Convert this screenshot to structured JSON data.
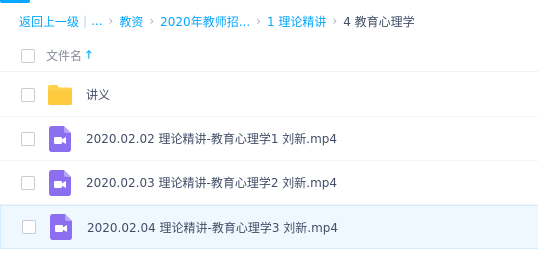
{
  "breadcrumb": {
    "back": "返回上一级",
    "ellipsis": "...",
    "items": [
      "教资",
      "2020年教师招...",
      "1 理论精讲"
    ],
    "current": "4 教育心理学"
  },
  "list_header": {
    "name_label": "文件名",
    "sort_icon": "arrow-up-icon"
  },
  "files": [
    {
      "name": "讲义",
      "type": "folder",
      "icon": "folder-icon"
    },
    {
      "name": "2020.02.02 理论精讲-教育心理学1 刘新.mp4",
      "type": "video",
      "icon": "video-file-icon"
    },
    {
      "name": "2020.02.03 理论精讲-教育心理学2 刘新.mp4",
      "type": "video",
      "icon": "video-file-icon"
    },
    {
      "name": "2020.02.04 理论精讲-教育心理学3 刘新.mp4",
      "type": "video",
      "icon": "video-file-icon"
    }
  ],
  "colors": {
    "accent": "#06a7ff",
    "folder": "#ffd04b",
    "video": "#8b6ff0",
    "row_highlight": "#f0f8ff"
  }
}
